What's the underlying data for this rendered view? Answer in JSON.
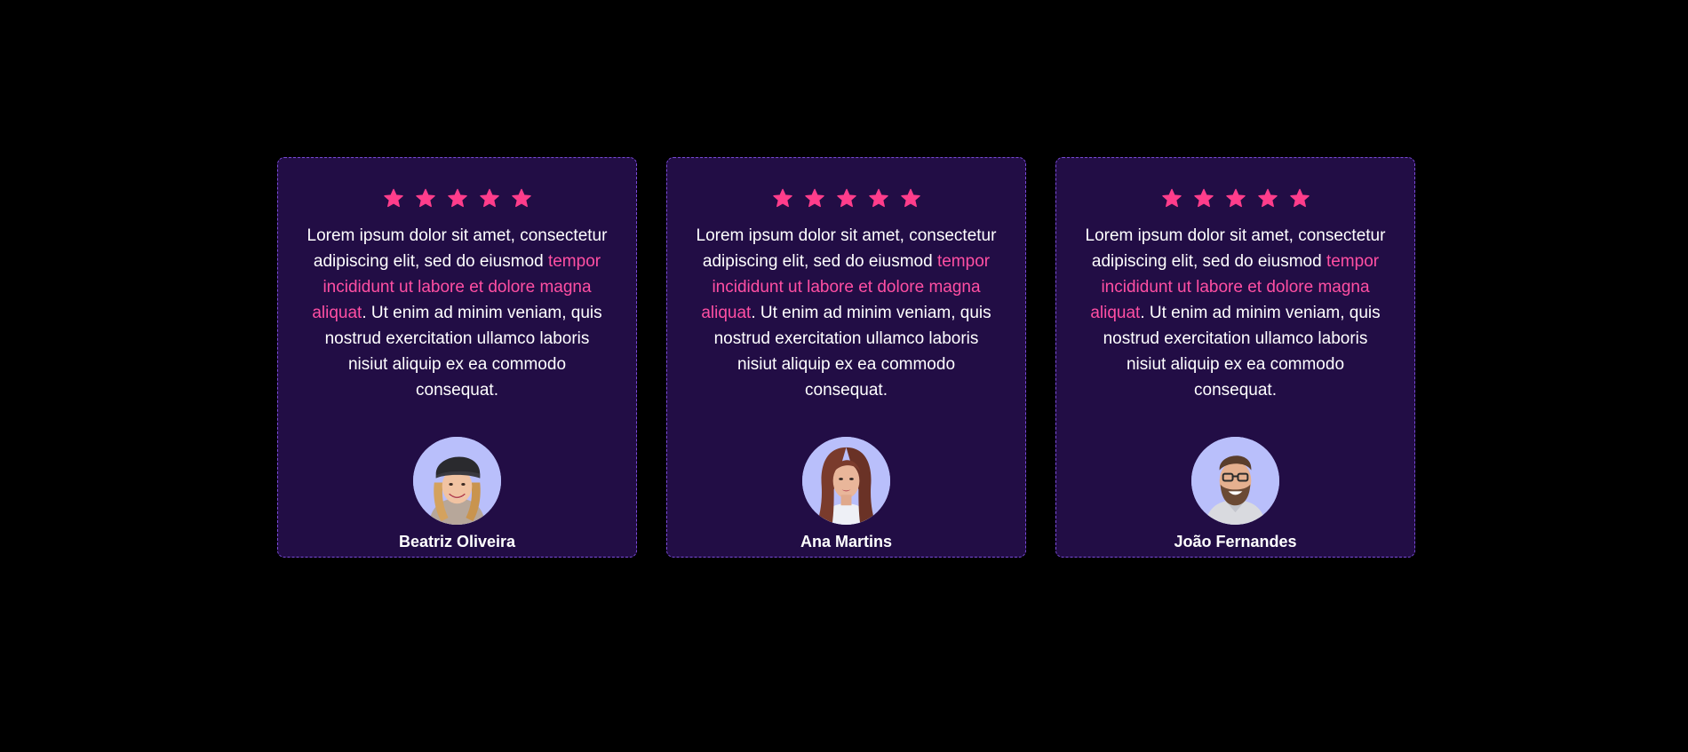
{
  "colors": {
    "page_background": "#000000",
    "card_background": "#220d45",
    "card_border": "#7a4bd9",
    "star": "#ff3d8b",
    "highlight_text": "#ff4fa3",
    "avatar_background": "#b9bffb"
  },
  "testimonials": [
    {
      "rating": 5,
      "star_icon": "star-icon",
      "text_before": "Lorem ipsum dolor sit amet, consectetur adipiscing elit, sed do eiusmod ",
      "text_highlight": "tempor incididunt ut labore et dolore magna aliquat",
      "text_after": ". Ut enim ad minim veniam, quis nostrud exercitation ullamco laboris nisiut aliquip ex ea commodo consequat.",
      "name": "Beatriz Oliveira"
    },
    {
      "rating": 5,
      "star_icon": "star-icon",
      "text_before": "Lorem ipsum dolor sit amet, consectetur adipiscing elit, sed do eiusmod ",
      "text_highlight": "tempor incididunt ut labore et dolore magna aliquat",
      "text_after": ". Ut enim ad minim veniam, quis nostrud exercitation ullamco laboris nisiut aliquip ex ea commodo consequat.",
      "name": "Ana Martins"
    },
    {
      "rating": 5,
      "star_icon": "star-icon",
      "text_before": "Lorem ipsum dolor sit amet, consectetur adipiscing elit, sed do eiusmod ",
      "text_highlight": "tempor incididunt ut labore et dolore magna aliquat",
      "text_after": ". Ut enim ad minim veniam, quis nostrud exercitation ullamco laboris nisiut aliquip ex ea commodo consequat.",
      "name": "João Fernandes"
    }
  ]
}
